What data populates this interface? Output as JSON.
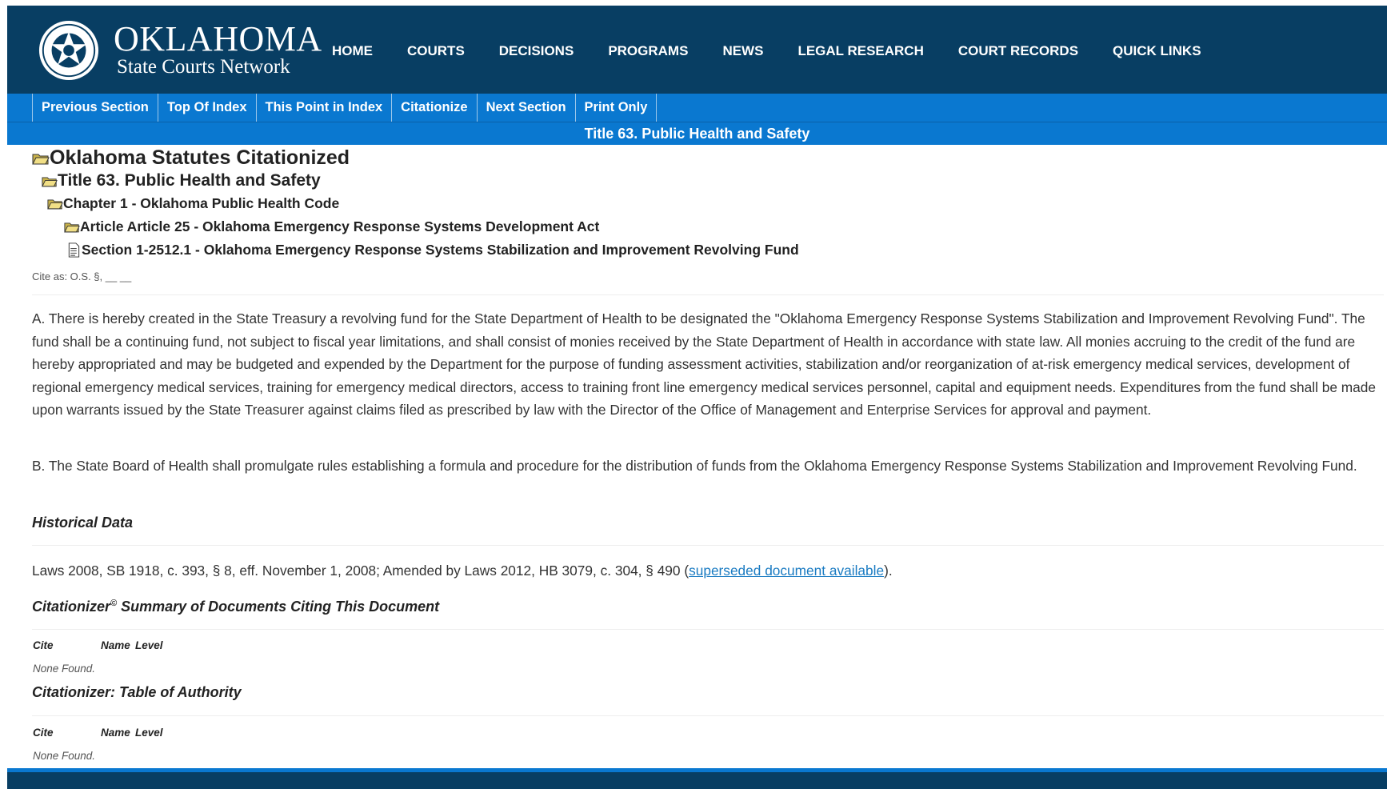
{
  "header": {
    "logo_line1": "OKLAHOMA",
    "logo_line2": "State Courts Network",
    "nav": [
      "HOME",
      "COURTS",
      "DECISIONS",
      "PROGRAMS",
      "NEWS",
      "LEGAL RESEARCH",
      "COURT RECORDS",
      "QUICK LINKS"
    ]
  },
  "subnav": {
    "tabs": [
      "Previous Section",
      "Top Of Index",
      "This Point in Index",
      "Citationize",
      "Next Section",
      "Print Only"
    ]
  },
  "title_bar": "Title 63. Public Health and Safety",
  "breadcrumb": {
    "root": "Oklahoma Statutes Citationized",
    "title": "Title 63. Public Health and Safety",
    "chapter": "Chapter 1 - Oklahoma Public Health Code",
    "article": "Article Article 25 - Oklahoma Emergency Response Systems Development Act",
    "section": "Section 1-2512.1 - Oklahoma Emergency Response Systems Stabilization and Improvement Revolving Fund"
  },
  "cite_as": "Cite as: O.S. §, __ __",
  "body": {
    "para_a": "A. There is hereby created in the State Treasury a revolving fund for the State Department of Health to be designated the \"Oklahoma Emergency Response Systems Stabilization and Improvement Revolving Fund\". The fund shall be a continuing fund, not subject to fiscal year limitations, and shall consist of monies received by the State Department of Health in accordance with state law. All monies accruing to the credit of the fund are hereby appropriated and may be budgeted and expended by the Department for the purpose of funding assessment activities, stabilization and/or reorganization of at-risk emergency medical services, development of regional emergency medical services, training for emergency medical directors, access to training front line emergency medical services personnel, capital and equipment needs. Expenditures from the fund shall be made upon warrants issued by the State Treasurer against claims filed as prescribed by law with the Director of the Office of Management and Enterprise Services for approval and payment.",
    "para_b": "B. The State Board of Health shall promulgate rules establishing a formula and procedure for the distribution of funds from the Oklahoma Emergency Response Systems Stabilization and Improvement Revolving Fund."
  },
  "historical": {
    "heading": "Historical Data",
    "laws_prefix": "Laws 2008, SB 1918, c. 393, § 8, eff. November 1, 2008; Amended by Laws 2012, HB 3079, c. 304, § 490 (",
    "link": "superseded document available",
    "laws_suffix": ")."
  },
  "citationizer": {
    "heading": "Citationizer",
    "sup": "©",
    "heading_rest": " Summary of Documents Citing This Document",
    "col_cite": "Cite",
    "col_name": "Name",
    "col_level": "Level",
    "none": "None Found."
  },
  "authority": {
    "heading": "Citationizer: Table of Authority",
    "col_cite": "Cite",
    "col_name": "Name",
    "col_level": "Level",
    "none": "None Found."
  },
  "colors": {
    "header_bg": "#083e63",
    "subnav_bg": "#0a78d0",
    "link": "#1a7bc2"
  }
}
